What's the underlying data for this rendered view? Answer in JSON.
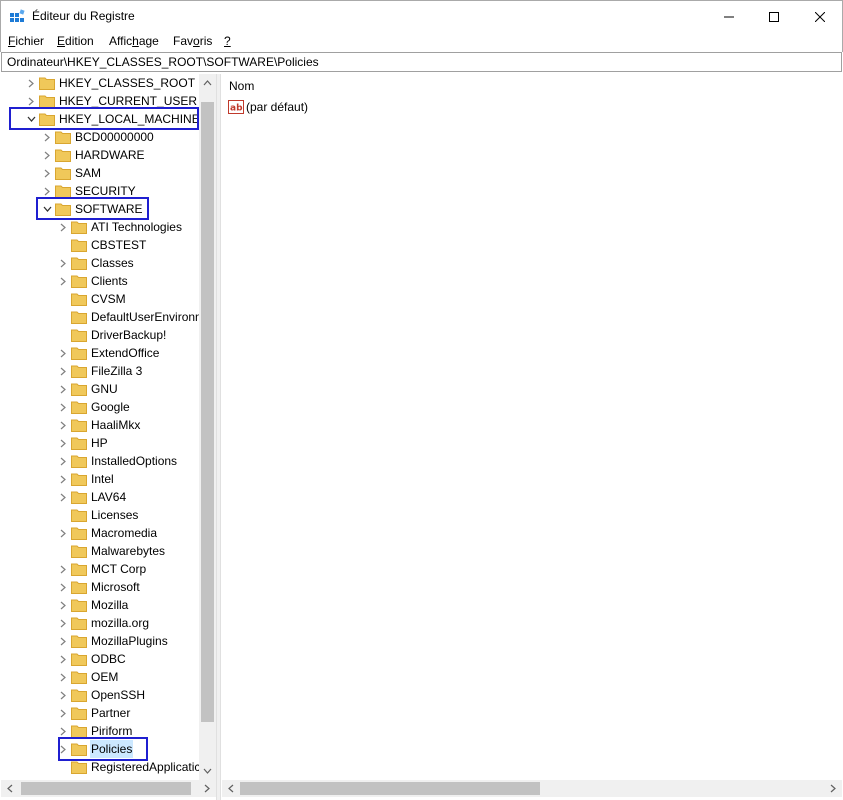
{
  "window": {
    "title": "Éditeur du Registre"
  },
  "menu": {
    "items": [
      {
        "label": "Fichier",
        "accel": "F",
        "rest": "ichier"
      },
      {
        "label": "Edition",
        "accel": "E",
        "rest": "dition"
      },
      {
        "label": "Affichage",
        "pre": "Affic",
        "accel": "h",
        "rest": "age"
      },
      {
        "label": "Favoris",
        "pre": "Fav",
        "accel": "o",
        "rest": "ris"
      },
      {
        "label": "?",
        "accel": "?",
        "rest": ""
      }
    ]
  },
  "address": {
    "path": "Ordinateur\\HKEY_CLASSES_ROOT\\SOFTWARE\\Policies"
  },
  "tree": {
    "items": [
      {
        "label": "HKEY_CLASSES_ROOT",
        "level": 0,
        "state": "collapsed"
      },
      {
        "label": "HKEY_CURRENT_USER",
        "level": 0,
        "state": "collapsed"
      },
      {
        "label": "HKEY_LOCAL_MACHINE",
        "level": 0,
        "state": "expanded"
      },
      {
        "label": "BCD00000000",
        "level": 1,
        "state": "collapsed"
      },
      {
        "label": "HARDWARE",
        "level": 1,
        "state": "collapsed"
      },
      {
        "label": "SAM",
        "level": 1,
        "state": "collapsed"
      },
      {
        "label": "SECURITY",
        "level": 1,
        "state": "collapsed"
      },
      {
        "label": "SOFTWARE",
        "level": 1,
        "state": "expanded"
      },
      {
        "label": "ATI Technologies",
        "level": 2,
        "state": "collapsed"
      },
      {
        "label": "CBSTEST",
        "level": 2,
        "state": "none"
      },
      {
        "label": "Classes",
        "level": 2,
        "state": "collapsed"
      },
      {
        "label": "Clients",
        "level": 2,
        "state": "collapsed"
      },
      {
        "label": "CVSM",
        "level": 2,
        "state": "none"
      },
      {
        "label": "DefaultUserEnvironn",
        "level": 2,
        "state": "none"
      },
      {
        "label": "DriverBackup!",
        "level": 2,
        "state": "none"
      },
      {
        "label": "ExtendOffice",
        "level": 2,
        "state": "collapsed"
      },
      {
        "label": "FileZilla 3",
        "level": 2,
        "state": "collapsed"
      },
      {
        "label": "GNU",
        "level": 2,
        "state": "collapsed"
      },
      {
        "label": "Google",
        "level": 2,
        "state": "collapsed"
      },
      {
        "label": "HaaliMkx",
        "level": 2,
        "state": "collapsed"
      },
      {
        "label": "HP",
        "level": 2,
        "state": "collapsed"
      },
      {
        "label": "InstalledOptions",
        "level": 2,
        "state": "collapsed"
      },
      {
        "label": "Intel",
        "level": 2,
        "state": "collapsed"
      },
      {
        "label": "LAV64",
        "level": 2,
        "state": "collapsed"
      },
      {
        "label": "Licenses",
        "level": 2,
        "state": "none"
      },
      {
        "label": "Macromedia",
        "level": 2,
        "state": "collapsed"
      },
      {
        "label": "Malwarebytes",
        "level": 2,
        "state": "none"
      },
      {
        "label": "MCT Corp",
        "level": 2,
        "state": "collapsed"
      },
      {
        "label": "Microsoft",
        "level": 2,
        "state": "collapsed"
      },
      {
        "label": "Mozilla",
        "level": 2,
        "state": "collapsed"
      },
      {
        "label": "mozilla.org",
        "level": 2,
        "state": "collapsed"
      },
      {
        "label": "MozillaPlugins",
        "level": 2,
        "state": "collapsed"
      },
      {
        "label": "ODBC",
        "level": 2,
        "state": "collapsed"
      },
      {
        "label": "OEM",
        "level": 2,
        "state": "collapsed"
      },
      {
        "label": "OpenSSH",
        "level": 2,
        "state": "collapsed"
      },
      {
        "label": "Partner",
        "level": 2,
        "state": "collapsed"
      },
      {
        "label": "Piriform",
        "level": 2,
        "state": "collapsed"
      },
      {
        "label": "Policies",
        "level": 2,
        "state": "collapsed",
        "selected": true
      },
      {
        "label": "RegisteredApplicatic",
        "level": 2,
        "state": "none"
      }
    ]
  },
  "values_pane": {
    "column_name": "Nom",
    "rows": [
      {
        "name": "(par défaut)",
        "icon": "string-value-icon"
      }
    ]
  },
  "colors": {
    "highlight_border": "#1f1fd0",
    "selection": "#cce8ff",
    "folder": "#f0c85a"
  }
}
